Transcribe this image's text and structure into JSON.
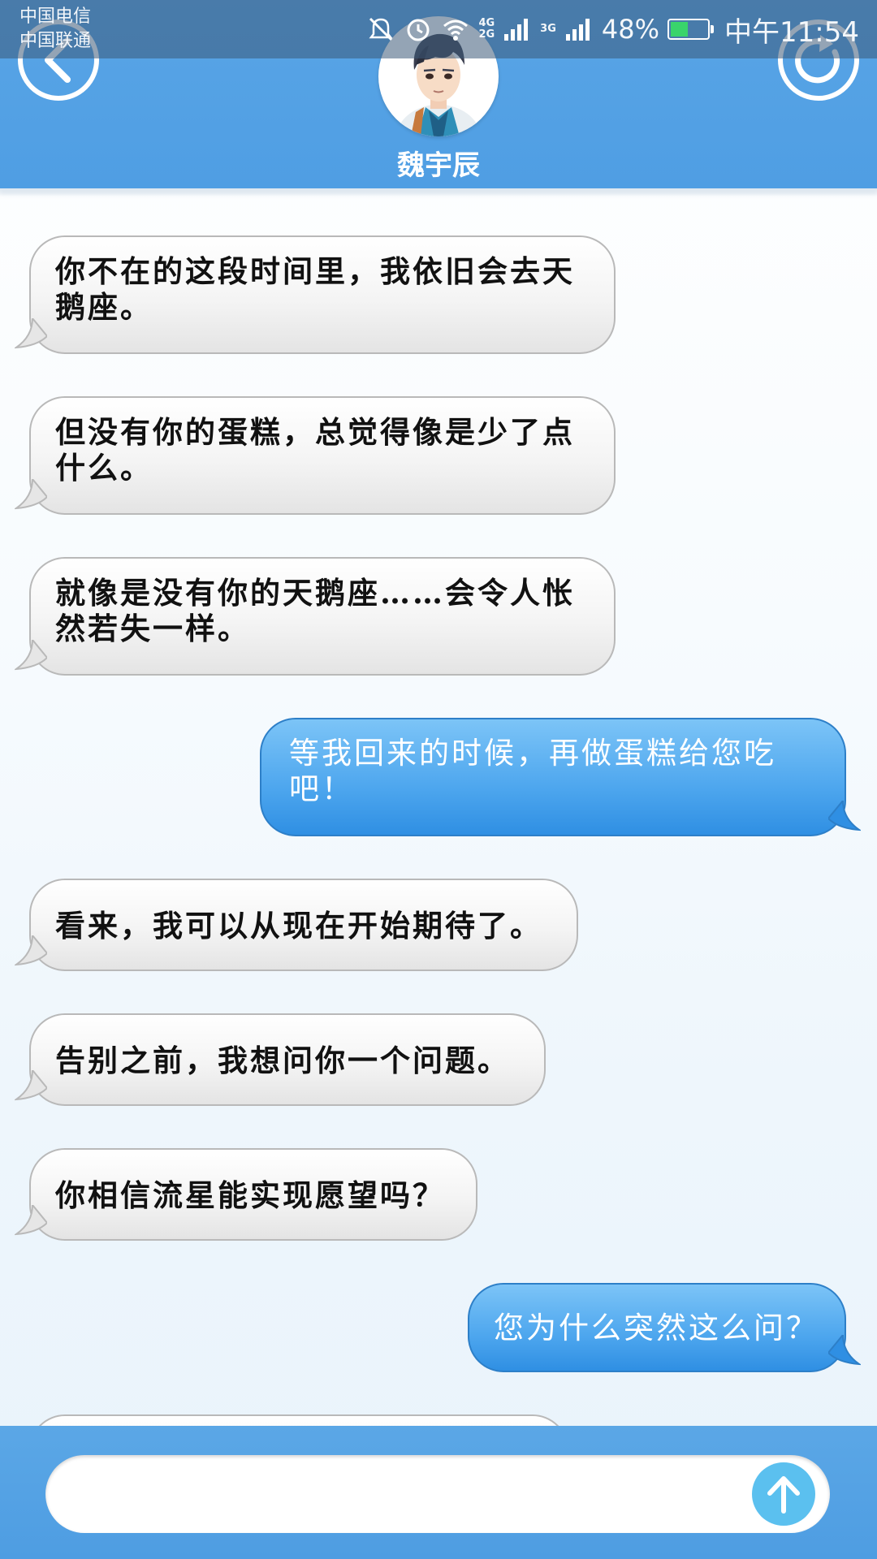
{
  "status_bar": {
    "carrier_1": "中国电信",
    "carrier_2": "中国联通",
    "net_1_top": "4G",
    "net_1_bottom": "2G",
    "net_2": "3G",
    "battery_percent": "48%",
    "battery_level": 0.48,
    "time": "中午11:54",
    "icons": [
      "mute-icon",
      "alarm-icon",
      "wifi-icon",
      "signal-icon",
      "battery-icon"
    ]
  },
  "header": {
    "contact_name": "魏宇辰",
    "back_icon": "chevron-left-icon",
    "refresh_icon": "refresh-icon"
  },
  "messages": [
    {
      "side": "left",
      "text": "你不在的这段时间里，我依旧会去天鹅座。"
    },
    {
      "side": "left",
      "text": "但没有你的蛋糕，总觉得像是少了点什么。"
    },
    {
      "side": "left",
      "text": "就像是没有你的天鹅座……会令人怅然若失一样。"
    },
    {
      "side": "right",
      "text": "等我回来的时候，再做蛋糕给您吃吧！"
    },
    {
      "side": "left",
      "text": "看来，我可以从现在开始期待了。"
    },
    {
      "side": "left",
      "text": "告别之前，我想问你一个问题。"
    },
    {
      "side": "left",
      "text": "你相信流星能实现愿望吗？"
    },
    {
      "side": "right",
      "text": "您为什么突然这么问？"
    }
  ],
  "input": {
    "placeholder": "",
    "value": "",
    "send_icon": "arrow-up-icon"
  },
  "colors": {
    "header_blue": "#4f9ee3",
    "bubble_right": "#4da6ee",
    "send_button": "#5bc0ef",
    "battery_green": "#39d46b"
  }
}
